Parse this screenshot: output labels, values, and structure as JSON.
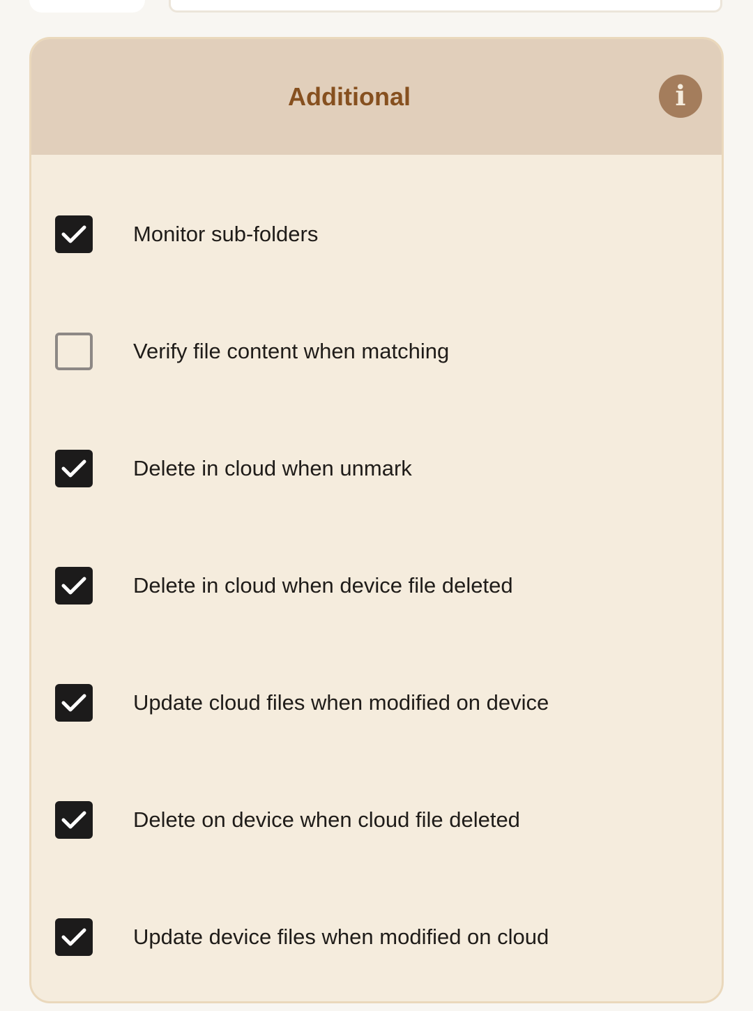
{
  "card": {
    "title": "Additional",
    "info_icon": "info-icon",
    "info_glyph": "i"
  },
  "options": [
    {
      "label": "Monitor sub-folders",
      "checked": true
    },
    {
      "label": "Verify file content when matching",
      "checked": false
    },
    {
      "label": "Delete in cloud when unmark",
      "checked": true
    },
    {
      "label": "Delete in cloud when device file deleted",
      "checked": true
    },
    {
      "label": "Update cloud files when modified on device",
      "checked": true
    },
    {
      "label": "Delete on device when cloud file deleted",
      "checked": true
    },
    {
      "label": "Update device files when modified on cloud",
      "checked": true
    }
  ],
  "colors": {
    "header_bg": "#e1cfbb",
    "card_bg": "#f5ecdd",
    "title": "#86501f",
    "checkbox_checked": "#1c1b1b",
    "checkbox_unchecked_border": "#8d8885",
    "logo_ring": "#7b2fa8"
  }
}
